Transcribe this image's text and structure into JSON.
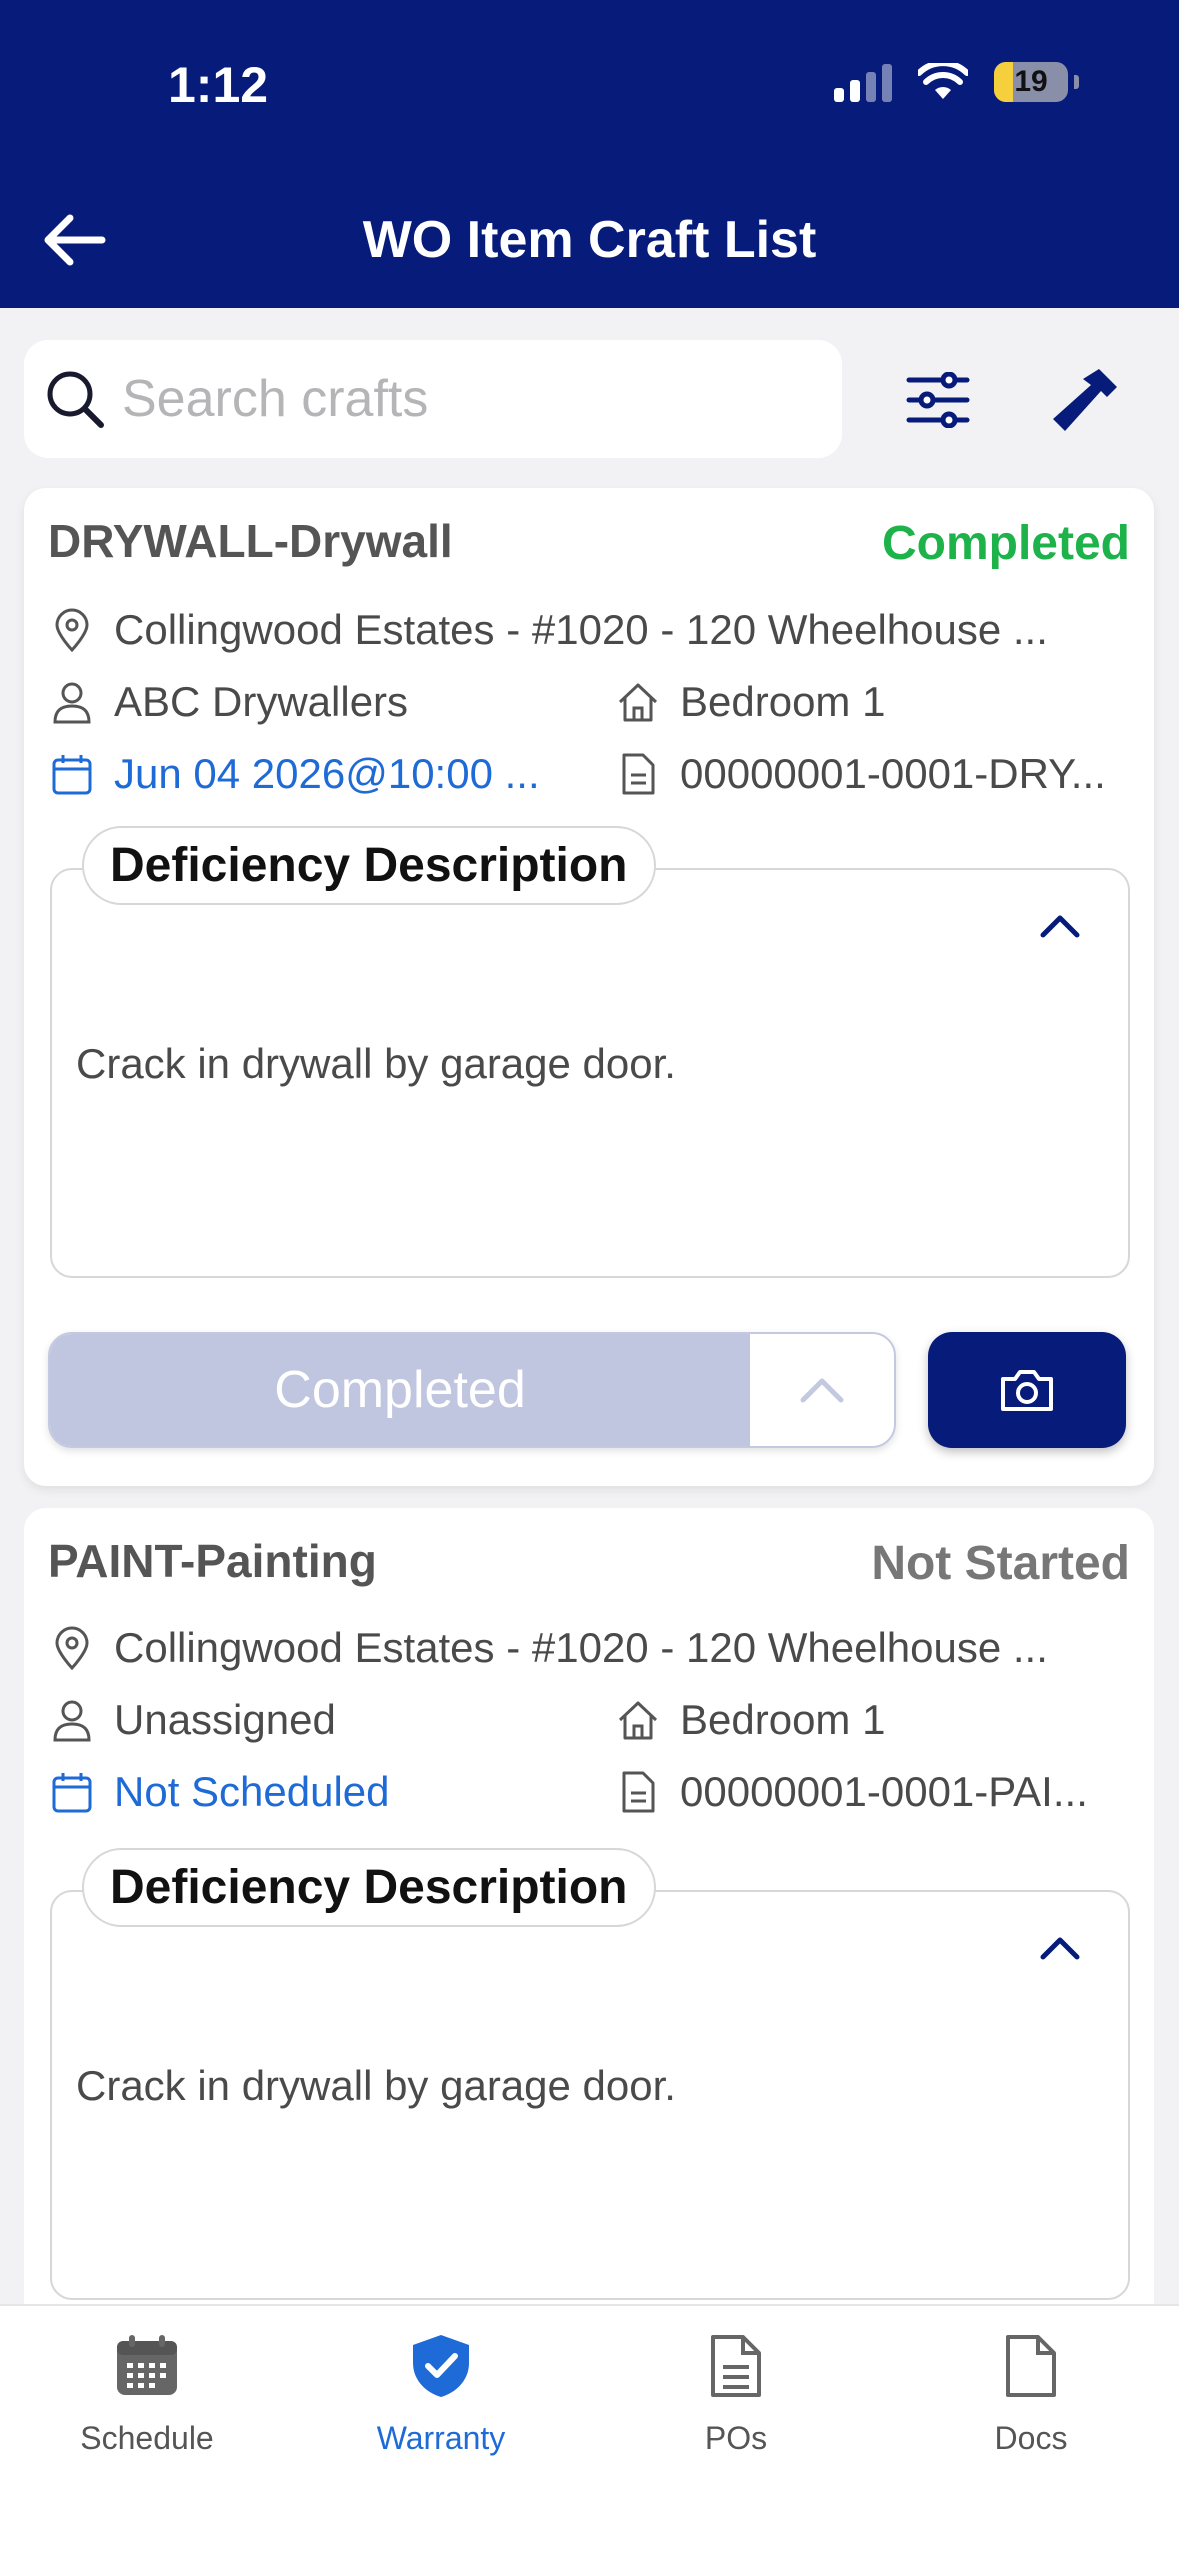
{
  "status_bar": {
    "time": "1:12",
    "battery": "19"
  },
  "header": {
    "title": "WO Item Craft List"
  },
  "search": {
    "placeholder": "Search crafts",
    "value": ""
  },
  "crafts": [
    {
      "name": "DRYWALL-Drywall",
      "status": "Completed",
      "location": "Collingwood Estates - #1020 - 120 Wheelhouse ...",
      "assignee": "ABC Drywallers",
      "room": "Bedroom 1",
      "schedule": "Jun 04 2026@10:00 ...",
      "doc_id": "00000001-0001-DRY...",
      "description_label": "Deficiency Description",
      "description": "Crack in drywall by garage door.",
      "status_select": "Completed"
    },
    {
      "name": "PAINT-Painting",
      "status": "Not Started",
      "location": "Collingwood Estates - #1020 - 120 Wheelhouse ...",
      "assignee": "Unassigned",
      "room": "Bedroom 1",
      "schedule": "Not Scheduled",
      "doc_id": "00000001-0001-PAI...",
      "description_label": "Deficiency Description",
      "description": "Crack in drywall by garage door."
    }
  ],
  "tabbar": {
    "items": [
      {
        "label": "Schedule",
        "icon": "calendar-icon"
      },
      {
        "label": "Warranty",
        "icon": "shield-check-icon",
        "active": true
      },
      {
        "label": "POs",
        "icon": "document-icon"
      },
      {
        "label": "Docs",
        "icon": "file-icon"
      }
    ]
  },
  "colors": {
    "header": "#071b7a",
    "completed": "#1db34a",
    "link": "#1e6ad6",
    "muted_status": "#777777"
  }
}
